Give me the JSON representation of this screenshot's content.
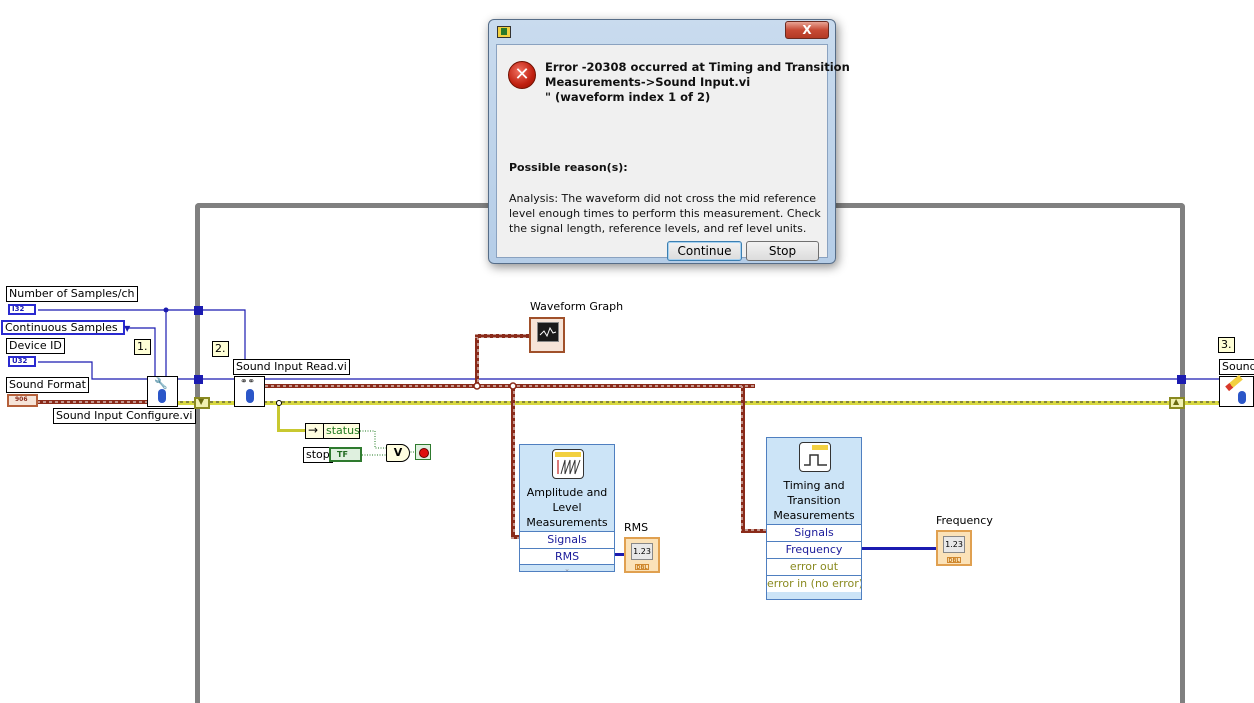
{
  "block_diagram": {
    "controls": {
      "num_samples": {
        "label": "Number of Samples/ch",
        "type_tag": "I32"
      },
      "sample_mode": {
        "value": "Continuous Samples"
      },
      "device_id": {
        "label": "Device ID",
        "type_tag": "U32"
      },
      "sound_format": {
        "label": "Sound Format",
        "type_tag": "906"
      }
    },
    "sequence_labels": [
      "1.",
      "2.",
      "3."
    ],
    "subvis": {
      "configure": {
        "label": "Sound Input Configure.vi"
      },
      "read": {
        "label": "Sound Input Read.vi"
      },
      "clear": {
        "label": "Sound"
      }
    },
    "waveform_graph": {
      "label": "Waveform Graph"
    },
    "status": {
      "label": "status"
    },
    "stop": {
      "label": "stop",
      "type_tag": "TF"
    },
    "or_gate": {
      "symbol": "V"
    },
    "amplitude_express": {
      "title": "Amplitude and Level Measurements",
      "title_lines": [
        "Amplitude and",
        "Level",
        "Measurements"
      ],
      "rows": [
        "Signals",
        "RMS"
      ]
    },
    "timing_express": {
      "title_lines": [
        "Timing and",
        "Transition",
        "Measurements"
      ],
      "rows": [
        "Signals",
        "Frequency",
        "error out",
        "error in (no error)"
      ]
    },
    "rms_indicator": {
      "label": "RMS",
      "value": "1.23",
      "type_tag": "DBL"
    },
    "frequency_indicator": {
      "label": "Frequency",
      "value": "1.23",
      "type_tag": "DBL"
    }
  },
  "dialog": {
    "error_line1": "Error -20308 occurred at Timing and Transition",
    "error_line2": "Measurements->Sound Input.vi",
    "error_line3": "\"  (waveform index 1 of 2)",
    "reasons_heading": "Possible reason(s):",
    "reason_line1": "Analysis:  The waveform did not cross the mid reference",
    "reason_line2": "level enough times to perform this measurement. Check",
    "reason_line3": "the signal length, reference levels, and ref level units.",
    "continue_label": "Continue",
    "stop_label": "Stop",
    "close_label": "X"
  },
  "colors": {
    "numeric_wire": "#1b1bb0",
    "waveform_wire": "#8a2b1a",
    "error_wire": "#9a9a20",
    "while_loop_border": "#808080",
    "express_bg": "#cce4f7"
  }
}
